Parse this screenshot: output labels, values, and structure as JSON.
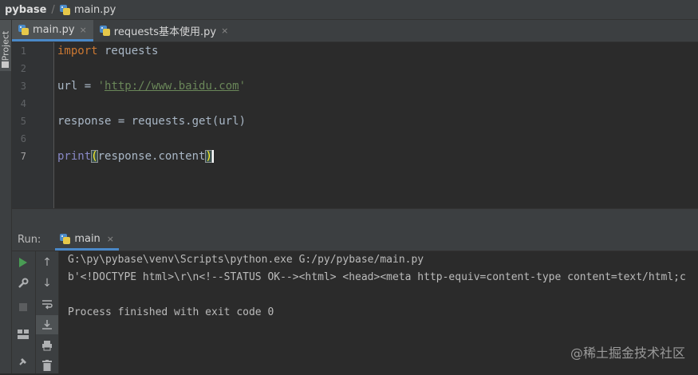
{
  "breadcrumb": {
    "project": "pybase",
    "file": "main.py"
  },
  "sidebar": {
    "project_label": "Project"
  },
  "tabs": [
    {
      "label": "main.py",
      "close": "×"
    },
    {
      "label": "requests基本使用.py",
      "close": "×"
    }
  ],
  "editor": {
    "line_numbers": [
      "1",
      "2",
      "3",
      "4",
      "5",
      "6",
      "7"
    ],
    "line1": {
      "keyword": "import",
      "rest": " requests"
    },
    "line3": {
      "lhs": "url = ",
      "quote_open": "'",
      "url": "http://www.baidu.com",
      "quote_close": "'"
    },
    "line5": {
      "text": "response = requests.get(url)"
    },
    "line7": {
      "fn": "print",
      "open": "(",
      "arg": "response.content",
      "close": ")"
    }
  },
  "run": {
    "label": "Run:",
    "tab_label": "main",
    "tab_close": "×",
    "icons": [
      "run-icon",
      "wrench-icon",
      "stop-icon",
      "layout-icon",
      "pin-icon",
      "up-arrow-icon",
      "down-arrow-icon",
      "soft-wrap-icon",
      "scroll-to-end-icon",
      "print-icon",
      "trash-icon"
    ],
    "console": [
      "G:\\py\\pybase\\venv\\Scripts\\python.exe G:/py/pybase/main.py",
      "b'<!DOCTYPE html>\\r\\n<!--STATUS OK--><html> <head><meta http-equiv=content-type content=text/html;c",
      "",
      "Process finished with exit code 0"
    ]
  },
  "watermark": "@稀土掘金技术社区",
  "colors": {
    "background": "#2b2b2b",
    "panel": "#3c3f41",
    "keyword": "#cc7832",
    "string": "#6a8759",
    "builtin": "#8888c6",
    "accent": "#4a88c7",
    "run_green": "#499c54"
  }
}
